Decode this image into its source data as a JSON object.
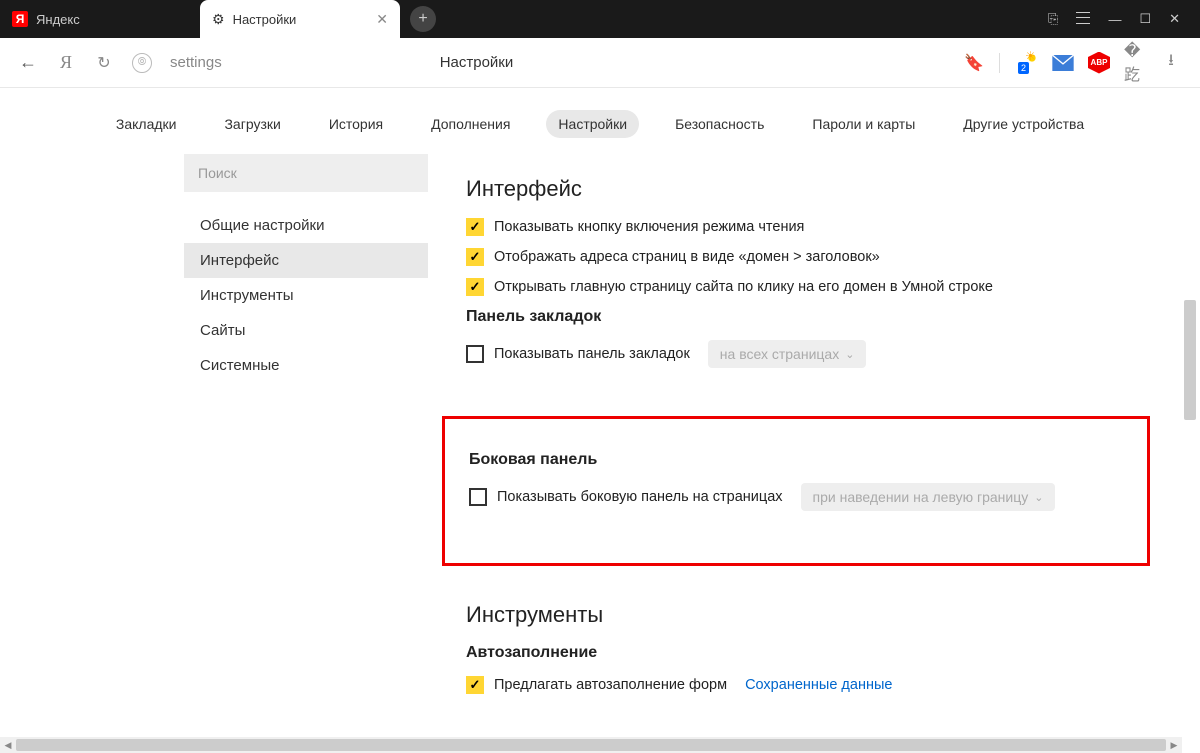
{
  "tabs": {
    "inactive": "Яндекс",
    "active": "Настройки"
  },
  "address": {
    "url": "settings",
    "title": "Настройки"
  },
  "weather_badge": "2",
  "abp_label": "ABP",
  "topnav": {
    "bookmarks": "Закладки",
    "downloads": "Загрузки",
    "history": "История",
    "addons": "Дополнения",
    "settings": "Настройки",
    "security": "Безопасность",
    "passwords": "Пароли и карты",
    "devices": "Другие устройства"
  },
  "sidebar": {
    "search_placeholder": "Поиск",
    "general": "Общие настройки",
    "interface": "Интерфейс",
    "tools": "Инструменты",
    "sites": "Сайты",
    "system": "Системные"
  },
  "sections": {
    "interface": {
      "title": "Интерфейс",
      "reader": "Показывать кнопку включения режима чтения",
      "domain": "Отображать адреса страниц в виде «домен > заголовок»",
      "smartline": "Открывать главную страницу сайта по клику на его домен в Умной строке",
      "bookmarks_h": "Панель закладок",
      "bookmarks_cb": "Показывать панель закладок",
      "bookmarks_sel": "на всех страницах",
      "sidepanel_h": "Боковая панель",
      "sidepanel_cb": "Показывать боковую панель на страницах",
      "sidepanel_sel": "при наведении на левую границу"
    },
    "tools": {
      "title": "Инструменты",
      "autofill_h": "Автозаполнение",
      "autofill_cb": "Предлагать автозаполнение форм",
      "autofill_link": "Сохраненные данные"
    }
  }
}
